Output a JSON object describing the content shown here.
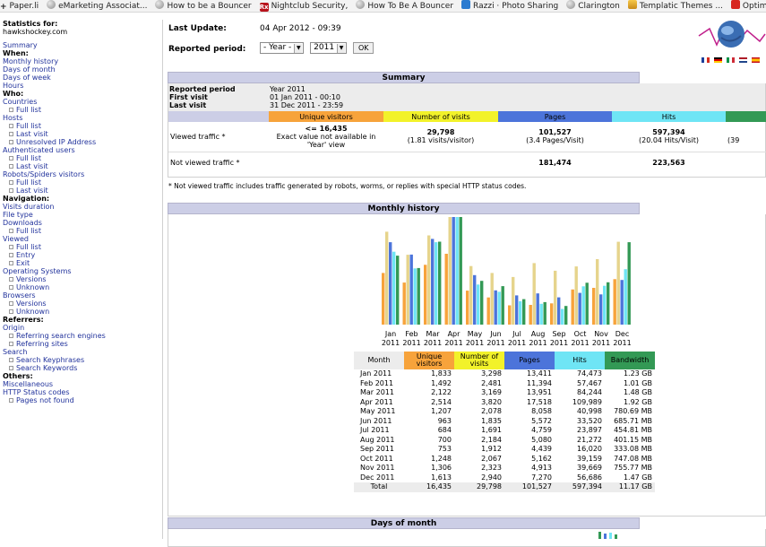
{
  "bookmarks": [
    {
      "icon": "plus-icon",
      "label": "Paper.li"
    },
    {
      "icon": "globe-icon",
      "label": "eMarketing Associat..."
    },
    {
      "icon": "globe-icon",
      "label": "How to be a Bouncer"
    },
    {
      "icon": "rx-icon",
      "label": "Nightclub Security,"
    },
    {
      "icon": "globe-icon",
      "label": "How To Be A Bouncer"
    },
    {
      "icon": "razzi-icon",
      "label": "Razzi · Photo Sharing"
    },
    {
      "icon": "globe-icon",
      "label": "Clarington"
    },
    {
      "icon": "templatic-icon",
      "label": "Templatic Themes ..."
    },
    {
      "icon": "optimize-icon",
      "label": "Optimize You"
    }
  ],
  "menu": {
    "stats_for": "Statistics for:",
    "site": "hawkshockey.com",
    "summary": "Summary",
    "when": "When:",
    "monthly_history": "Monthly history",
    "days_of_month": "Days of month",
    "days_of_week": "Days of week",
    "hours": "Hours",
    "who": "Who:",
    "countries": "Countries",
    "countries_full": "Full list",
    "hosts": "Hosts",
    "hosts_full": "Full list",
    "hosts_last": "Last visit",
    "hosts_unresolved": "Unresolved IP Address",
    "auth_users": "Authenticated users",
    "auth_full": "Full list",
    "auth_last": "Last visit",
    "robots": "Robots/Spiders visitors",
    "robots_full": "Full list",
    "robots_last": "Last visit",
    "navigation": "Navigation:",
    "visits_duration": "Visits duration",
    "file_type": "File type",
    "downloads": "Downloads",
    "downloads_full": "Full list",
    "viewed": "Viewed",
    "viewed_full": "Full list",
    "viewed_entry": "Entry",
    "viewed_exit": "Exit",
    "os": "Operating Systems",
    "os_versions": "Versions",
    "os_unknown": "Unknown",
    "browsers": "Browsers",
    "browsers_versions": "Versions",
    "browsers_unknown": "Unknown",
    "referrers": "Referrers:",
    "origin": "Origin",
    "ref_engines": "Referring search engines",
    "ref_sites": "Referring sites",
    "search": "Search",
    "search_keyphrases": "Search Keyphrases",
    "search_keywords": "Search Keywords",
    "others": "Others:",
    "misc": "Miscellaneous",
    "http_codes": "HTTP Status codes",
    "pages_not_found": "Pages not found"
  },
  "header": {
    "last_update_label": "Last Update:",
    "last_update_value": "04 Apr 2012 - 09:39",
    "reported_period_label": "Reported period:",
    "year_select_default": "- Year -",
    "year_select_value": "2011",
    "ok_label": "OK"
  },
  "summary": {
    "title": "Summary",
    "reported_period_label": "Reported period",
    "reported_period_value": "Year 2011",
    "first_visit_label": "First visit",
    "first_visit_value": "01 Jan 2011 - 00:10",
    "last_visit_label": "Last visit",
    "last_visit_value": "31 Dec 2011 - 23:59",
    "col_unique": "Unique visitors",
    "col_visits": "Number of visits",
    "col_pages": "Pages",
    "col_hits": "Hits",
    "viewed_label": "Viewed traffic *",
    "unique_value": "<= 16,435",
    "unique_note": "Exact value not available in 'Year' view",
    "visits_value": "29,798",
    "visits_sub": "(1.81 visits/visitor)",
    "pages_value": "101,527",
    "pages_sub": "(3.4 Pages/Visit)",
    "hits_value": "597,394",
    "hits_sub": "(20.04 Hits/Visit)",
    "bw_sub_partial": "(39",
    "not_viewed_label": "Not viewed traffic *",
    "nv_pages": "181,474",
    "nv_hits": "223,563",
    "footnote": "* Not viewed traffic includes traffic generated by robots, worms, or replies with special HTTP status codes."
  },
  "monthly": {
    "title": "Monthly history",
    "col_month": "Month",
    "col_unique": "Unique visitors",
    "col_visits": "Number of visits",
    "col_pages": "Pages",
    "col_hits": "Hits",
    "col_bw": "Bandwidth",
    "rows": [
      {
        "m": "Jan 2011",
        "u": "1,833",
        "v": "3,298",
        "p": "13,411",
        "h": "74,473",
        "b": "1.23 GB"
      },
      {
        "m": "Feb 2011",
        "u": "1,492",
        "v": "2,481",
        "p": "11,394",
        "h": "57,467",
        "b": "1.01 GB"
      },
      {
        "m": "Mar 2011",
        "u": "2,122",
        "v": "3,169",
        "p": "13,951",
        "h": "84,244",
        "b": "1.48 GB"
      },
      {
        "m": "Apr 2011",
        "u": "2,514",
        "v": "3,820",
        "p": "17,518",
        "h": "109,989",
        "b": "1.92 GB"
      },
      {
        "m": "May 2011",
        "u": "1,207",
        "v": "2,078",
        "p": "8,058",
        "h": "40,998",
        "b": "780.69 MB"
      },
      {
        "m": "Jun 2011",
        "u": "963",
        "v": "1,835",
        "p": "5,572",
        "h": "33,520",
        "b": "685.71 MB"
      },
      {
        "m": "Jul 2011",
        "u": "684",
        "v": "1,691",
        "p": "4,759",
        "h": "23,897",
        "b": "454.81 MB"
      },
      {
        "m": "Aug 2011",
        "u": "700",
        "v": "2,184",
        "p": "5,080",
        "h": "21,272",
        "b": "401.15 MB"
      },
      {
        "m": "Sep 2011",
        "u": "753",
        "v": "1,912",
        "p": "4,439",
        "h": "16,020",
        "b": "333.08 MB"
      },
      {
        "m": "Oct 2011",
        "u": "1,248",
        "v": "2,067",
        "p": "5,162",
        "h": "39,159",
        "b": "747.08 MB"
      },
      {
        "m": "Nov 2011",
        "u": "1,306",
        "v": "2,323",
        "p": "4,913",
        "h": "39,669",
        "b": "755.77 MB"
      },
      {
        "m": "Dec 2011",
        "u": "1,613",
        "v": "2,940",
        "p": "7,270",
        "h": "56,686",
        "b": "1.47 GB"
      }
    ],
    "total": {
      "m": "Total",
      "u": "16,435",
      "v": "29,798",
      "p": "101,527",
      "h": "597,394",
      "b": "11.17 GB"
    }
  },
  "days_of_month": {
    "title": "Days of month"
  },
  "colors": {
    "unique": "#f7a33b",
    "visits": "#f2f22a",
    "pages": "#4c74da",
    "hits": "#6fe5f5",
    "bandwidth": "#339955",
    "header": "#cccee6"
  },
  "chart_data": {
    "type": "bar",
    "categories": [
      "Jan",
      "Feb",
      "Mar",
      "Apr",
      "May",
      "Jun",
      "Jul",
      "Aug",
      "Sep",
      "Oct",
      "Nov",
      "Dec"
    ],
    "category_sublabels": [
      "2011",
      "2011",
      "2011",
      "2011",
      "2011",
      "2011",
      "2011",
      "2011",
      "2011",
      "2011",
      "2011",
      "2011"
    ],
    "series": [
      {
        "color": "#f7a33b",
        "values": [
          1833,
          1492,
          2122,
          2514,
          1207,
          963,
          684,
          700,
          753,
          1248,
          1306,
          1613
        ]
      },
      {
        "color": "#e6d48c",
        "values": [
          3298,
          2481,
          3169,
          3820,
          2078,
          1835,
          1691,
          2184,
          1912,
          2067,
          2323,
          2940
        ]
      },
      {
        "color": "#4c74da",
        "values": [
          13411,
          11394,
          13951,
          17518,
          8058,
          5572,
          4759,
          5080,
          4439,
          5162,
          4913,
          7270
        ]
      },
      {
        "color": "#6fe5f5",
        "values": [
          74473,
          57467,
          84244,
          109989,
          40998,
          33520,
          23897,
          21272,
          16020,
          39159,
          39669,
          56686
        ]
      },
      {
        "color": "#339955",
        "values": [
          1.23,
          1.01,
          1.48,
          1.92,
          0.78069,
          0.68571,
          0.45481,
          0.40115,
          0.33308,
          0.74708,
          0.75577,
          1.47
        ]
      }
    ]
  }
}
